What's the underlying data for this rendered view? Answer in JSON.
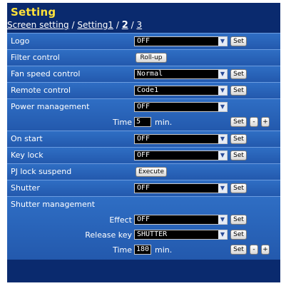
{
  "page": {
    "title": "Setting",
    "breadcrumb": {
      "screen_setting": "Screen setting",
      "sep1": "/",
      "setting1": "Setting1",
      "sep2": "/",
      "page2": "2",
      "sep3": "/",
      "page3": "3"
    }
  },
  "rows": {
    "logo": {
      "label": "Logo",
      "value": "OFF",
      "set": "Set"
    },
    "filter": {
      "label": "Filter control",
      "button": "Roll-up"
    },
    "fan": {
      "label": "Fan speed control",
      "value": "Normal",
      "set": "Set"
    },
    "remote": {
      "label": "Remote control",
      "value": "Code1",
      "set": "Set"
    },
    "power": {
      "label": "Power management",
      "value": "OFF",
      "time_label": "Time",
      "time_value": "5",
      "unit": "min.",
      "set": "Set",
      "minus": "-",
      "plus": "+"
    },
    "onstart": {
      "label": "On start",
      "value": "OFF",
      "set": "Set"
    },
    "keylock": {
      "label": "Key lock",
      "value": "OFF",
      "set": "Set"
    },
    "pjlock": {
      "label": "PJ lock suspend",
      "button": "Execute"
    },
    "shutter": {
      "label": "Shutter",
      "value": "OFF",
      "set": "Set"
    },
    "shutter_mgmt": {
      "label": "Shutter management",
      "effect_label": "Effect",
      "effect_value": "OFF",
      "effect_set": "Set",
      "release_label": "Release key",
      "release_value": "SHUTTER",
      "release_set": "Set",
      "time_label": "Time",
      "time_value": "180",
      "unit": "min.",
      "time_set": "Set",
      "minus": "-",
      "plus": "+"
    }
  },
  "colors": {
    "panel_bg": "#0a2a6e",
    "row_bg": "#2a62b8",
    "title": "#ffe23a"
  }
}
